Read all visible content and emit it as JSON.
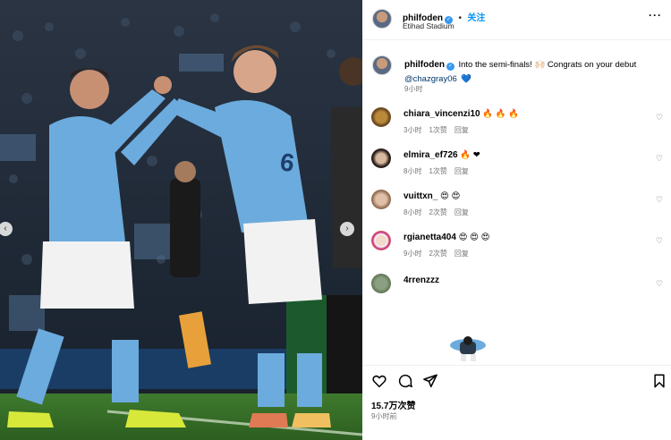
{
  "post": {
    "author": "philfoden",
    "follow_label": "关注",
    "location": "Etihad Stadium",
    "more_label": "···"
  },
  "caption": {
    "author": "philfoden",
    "text": "Into the semi-finals! 🙌🏻 Congrats on your debut",
    "mention": "@chazgray06",
    "heart": "💙",
    "time": "9小时"
  },
  "comments": [
    {
      "user": "chiara_vincenzi10",
      "text": "🔥 🔥 🔥",
      "time": "3小时",
      "likes": "1次赞",
      "reply": "回复"
    },
    {
      "user": "elmira_ef726",
      "text": "🔥 ❤",
      "time": "8小时",
      "likes": "1次赞",
      "reply": "回复"
    },
    {
      "user": "vuittxn_",
      "text": "😍 😍",
      "time": "8小时",
      "likes": "2次赞",
      "reply": "回复"
    },
    {
      "user": "rgianetta404",
      "text": "😍 😍 😍",
      "time": "9小时",
      "likes": "2次赞",
      "reply": "回复"
    },
    {
      "user": "4rrenzzz",
      "text": "",
      "time": "",
      "likes": "",
      "reply": ""
    }
  ],
  "footer": {
    "likes": "15.7万次赞",
    "time": "9小时前"
  },
  "icons": {
    "like": "heart-icon",
    "comment": "comment-icon",
    "share": "share-icon",
    "save": "bookmark-icon"
  },
  "colors": {
    "follow": "#0095f6",
    "verified": "#3897f0",
    "muted": "#737373",
    "mention": "#00376b"
  }
}
